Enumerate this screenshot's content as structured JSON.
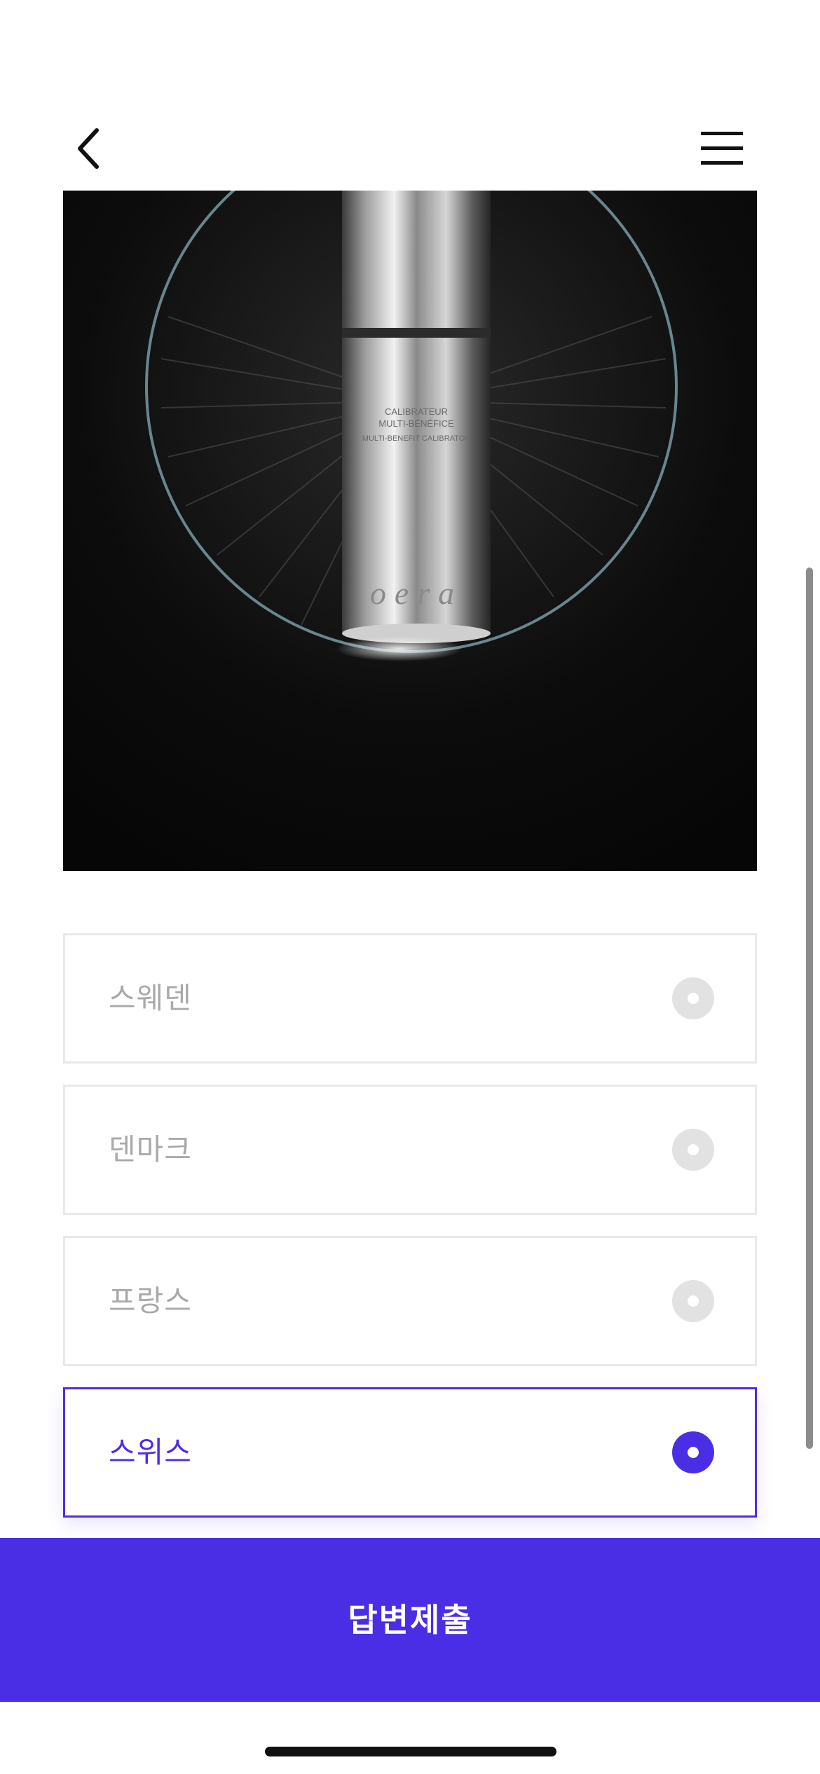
{
  "header": {
    "back_icon": "chevron-left-icon",
    "menu_icon": "hamburger-menu-icon"
  },
  "product": {
    "bottle_text_line1": "CALIBRATEUR",
    "bottle_text_line2": "MULTI-BÉNÉFICE",
    "bottle_text_line3": "MULTI-BENEFIT CALIBRATOR",
    "brand_text": "oera"
  },
  "options": [
    {
      "label": "스웨덴",
      "selected": false
    },
    {
      "label": "덴마크",
      "selected": false
    },
    {
      "label": "프랑스",
      "selected": false
    },
    {
      "label": "스위스",
      "selected": true
    }
  ],
  "submit": {
    "label": "답변제출"
  },
  "colors": {
    "accent": "#4a2ee6",
    "unselected_text": "#a9a9a9",
    "border": "#e9e9e9"
  }
}
